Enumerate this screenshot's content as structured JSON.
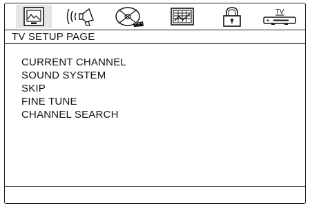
{
  "tabs": [
    {
      "icon": "picture-icon",
      "active": true
    },
    {
      "icon": "audio-icon",
      "active": false
    },
    {
      "icon": "disc-icon",
      "active": false
    },
    {
      "icon": "display-icon",
      "active": false
    },
    {
      "icon": "lock-icon",
      "active": false
    },
    {
      "icon": "tv-icon",
      "label": "TV",
      "active": false
    }
  ],
  "page_title": "TV SETUP PAGE",
  "menu_items": [
    {
      "label": "CURRENT CHANNEL"
    },
    {
      "label": "SOUND SYSTEM"
    },
    {
      "label": "SKIP"
    },
    {
      "label": "FINE TUNE"
    },
    {
      "label": "CHANNEL SEARCH"
    }
  ],
  "status_text": ""
}
